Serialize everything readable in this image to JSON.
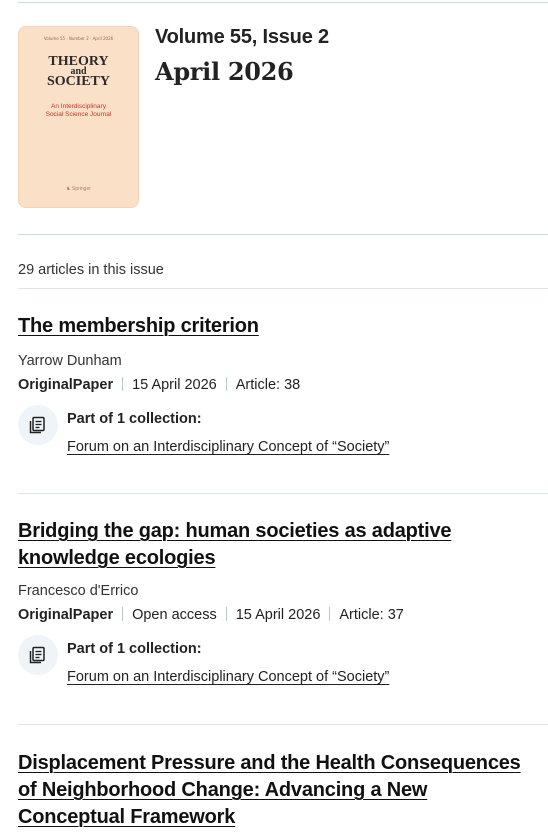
{
  "issue": {
    "volume_issue": "Volume 55, Issue 2",
    "date": "April 2026",
    "cover": {
      "top_line": "Volume 55 · Number 2 · April 2026",
      "title_lines": [
        "THEORY",
        "and",
        "SOCIETY"
      ],
      "subtitle_lines": [
        "An Interdisciplinary",
        "Social Science Journal"
      ],
      "publisher": "Springer",
      "background": "#fbe0c8",
      "subtitle_color": "#c0392b"
    }
  },
  "article_count": "29 articles in this issue",
  "articles": [
    {
      "title": "The membership criterion",
      "author": "Yarrow Dunham",
      "type": "OriginalPaper",
      "date": "15 April 2026",
      "article_no": "Article: 38",
      "collection_label": "Part of 1 collection:",
      "collection_link": "Forum on an Interdisciplinary Concept of “Society”",
      "icon": "collection-icon"
    },
    {
      "title": "Bridging the gap: human societies as adaptive knowledge ecologies",
      "author": "Francesco d'Errico",
      "type": "OriginalPaper",
      "access": "Open access",
      "date": "15 April 2026",
      "article_no": "Article: 37",
      "collection_label": "Part of 1 collection:",
      "collection_link": "Forum on an Interdisciplinary Concept of “Society”",
      "icon": "collection-icon"
    },
    {
      "title": "Displacement Pressure and the Health Consequences of Neighborhood Change: Advancing a New Conceptual Framework"
    }
  ],
  "colors": {
    "divider": "#c9dde6",
    "icon_circle": "#eef4f7",
    "text": "#222222"
  }
}
